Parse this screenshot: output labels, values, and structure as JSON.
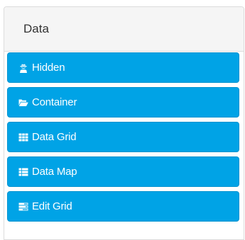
{
  "panel": {
    "title": "Data"
  },
  "components": [
    {
      "label": "Hidden",
      "icon": "user-secret-icon"
    },
    {
      "label": "Container",
      "icon": "folder-open-icon"
    },
    {
      "label": "Data Grid",
      "icon": "th-icon"
    },
    {
      "label": "Data Map",
      "icon": "th-list-icon"
    },
    {
      "label": "Edit Grid",
      "icon": "tasks-icon"
    }
  ],
  "colors": {
    "button_bg": "#00a3e6",
    "header_bg": "#f5f5f5",
    "border": "#dcdcdc"
  }
}
